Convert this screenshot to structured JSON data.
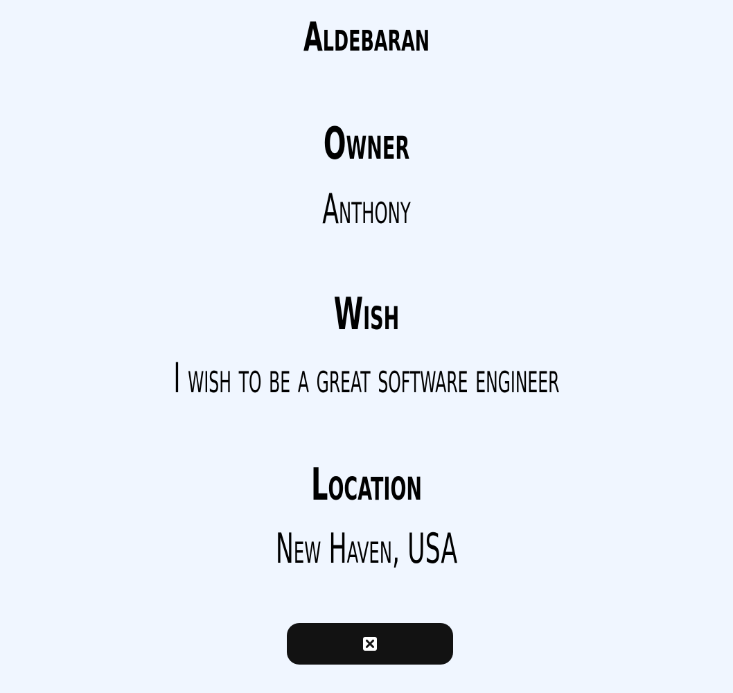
{
  "star": {
    "name": "Aldebaran"
  },
  "owner": {
    "label": "Owner",
    "value": "Anthony"
  },
  "wish": {
    "label": "Wish",
    "value": "I wish to be a great software engineer"
  },
  "location": {
    "label": "Location",
    "value": "New Haven, USA"
  },
  "close_button": {
    "icon": "close-square-icon"
  }
}
